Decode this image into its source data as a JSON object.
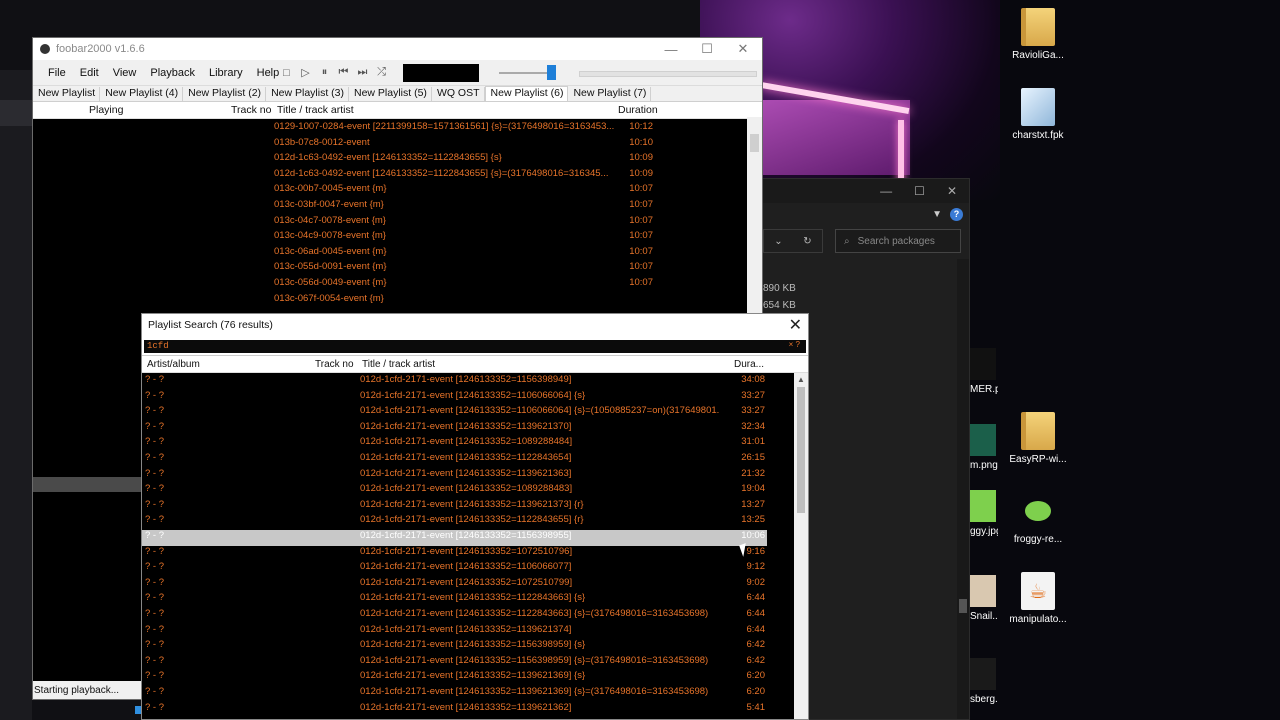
{
  "desktop": {
    "icons": [
      {
        "label": "RavioliGa...",
        "kind": "folder-icon"
      },
      {
        "label": "charstxt.fpk",
        "kind": "file-icon"
      },
      {
        "label": "EasyRP-wi...",
        "kind": "folder-icon"
      },
      {
        "label": "froggy-re...",
        "kind": "frog-icon"
      },
      {
        "label": "manipulato...",
        "kind": "java-icon"
      }
    ],
    "partial_icons": [
      "MER.png",
      "m.png",
      "ggy.jpg",
      "Snail...",
      "sberg..."
    ]
  },
  "background_window": {
    "search_placeholder": "Search packages",
    "sizes": [
      "890 KB",
      "654 KB"
    ]
  },
  "foobar": {
    "title": "foobar2000 v1.6.6",
    "menu": [
      "File",
      "Edit",
      "View",
      "Playback",
      "Library",
      "Help"
    ],
    "tabs": [
      "New Playlist",
      "New Playlist (4)",
      "New Playlist (2)",
      "New Playlist (3)",
      "New Playlist (5)",
      "WQ OST",
      "New Playlist (6)",
      "New Playlist (7)"
    ],
    "active_tab_index": 6,
    "columns": {
      "playing": "Playing",
      "track_no": "Track no",
      "title": "Title / track artist",
      "duration": "Duration"
    },
    "rows": [
      {
        "title": "0129-1007-0284-event [2211399158=1571361561] {s}=(3176498016=3163453...",
        "duration": "10:12"
      },
      {
        "title": "013b-07c8-0012-event",
        "duration": "10:10"
      },
      {
        "title": "012d-1c63-0492-event [1246133352=1122843655] {s}",
        "duration": "10:09"
      },
      {
        "title": "012d-1c63-0492-event [1246133352=1122843655] {s}=(3176498016=316345...",
        "duration": "10:09"
      },
      {
        "title": "013c-00b7-0045-event {m}",
        "duration": "10:07"
      },
      {
        "title": "013c-03bf-0047-event {m}",
        "duration": "10:07"
      },
      {
        "title": "013c-04c7-0078-event {m}",
        "duration": "10:07"
      },
      {
        "title": "013c-04c9-0078-event {m}",
        "duration": "10:07"
      },
      {
        "title": "013c-06ad-0045-event {m}",
        "duration": "10:07"
      },
      {
        "title": "013c-055d-0091-event {m}",
        "duration": "10:07"
      },
      {
        "title": "013c-056d-0049-event {m}",
        "duration": "10:07"
      },
      {
        "title": "013c-067f-0054-event {m}",
        "duration": ""
      }
    ],
    "status": "Starting playback..."
  },
  "search_dialog": {
    "title": "Playlist Search (76 results)",
    "query": "1cfd",
    "columns": {
      "artist": "Artist/album",
      "track_no": "Track no",
      "title": "Title / track artist",
      "duration": "Dura..."
    },
    "selected_index": 10,
    "rows": [
      {
        "artist": "? - ?",
        "title": "012d-1cfd-2171-event [1246133352=1156398949]",
        "duration": "34:08"
      },
      {
        "artist": "? - ?",
        "title": "012d-1cfd-2171-event [1246133352=1106066064] {s}",
        "duration": "33:27"
      },
      {
        "artist": "? - ?",
        "title": "012d-1cfd-2171-event [1246133352=1106066064] {s}=(1050885237=on)(317649801...",
        "duration": "33:27"
      },
      {
        "artist": "? - ?",
        "title": "012d-1cfd-2171-event [1246133352=1139621370]",
        "duration": "32:34"
      },
      {
        "artist": "? - ?",
        "title": "012d-1cfd-2171-event [1246133352=1089288484]",
        "duration": "31:01"
      },
      {
        "artist": "? - ?",
        "title": "012d-1cfd-2171-event [1246133352=1122843654]",
        "duration": "26:15"
      },
      {
        "artist": "? - ?",
        "title": "012d-1cfd-2171-event [1246133352=1139621363]",
        "duration": "21:32"
      },
      {
        "artist": "? - ?",
        "title": "012d-1cfd-2171-event [1246133352=1089288483]",
        "duration": "19:04"
      },
      {
        "artist": "? - ?",
        "title": "012d-1cfd-2171-event [1246133352=1139621373] {r}",
        "duration": "13:27"
      },
      {
        "artist": "? - ?",
        "title": "012d-1cfd-2171-event [1246133352=1122843655] {r}",
        "duration": "13:25"
      },
      {
        "artist": "? - ?",
        "title": "012d-1cfd-2171-event [1246133352=1156398955]",
        "duration": "10:06"
      },
      {
        "artist": "? - ?",
        "title": "012d-1cfd-2171-event [1246133352=1072510796]",
        "duration": "9:16"
      },
      {
        "artist": "? - ?",
        "title": "012d-1cfd-2171-event [1246133352=1106066077]",
        "duration": "9:12"
      },
      {
        "artist": "? - ?",
        "title": "012d-1cfd-2171-event [1246133352=1072510799]",
        "duration": "9:02"
      },
      {
        "artist": "? - ?",
        "title": "012d-1cfd-2171-event [1246133352=1122843663] {s}",
        "duration": "6:44"
      },
      {
        "artist": "? - ?",
        "title": "012d-1cfd-2171-event [1246133352=1122843663] {s}=(3176498016=3163453698)",
        "duration": "6:44"
      },
      {
        "artist": "? - ?",
        "title": "012d-1cfd-2171-event [1246133352=1139621374]",
        "duration": "6:44"
      },
      {
        "artist": "? - ?",
        "title": "012d-1cfd-2171-event [1246133352=1156398959] {s}",
        "duration": "6:42"
      },
      {
        "artist": "? - ?",
        "title": "012d-1cfd-2171-event [1246133352=1156398959] {s}=(3176498016=3163453698)",
        "duration": "6:42"
      },
      {
        "artist": "? - ?",
        "title": "012d-1cfd-2171-event [1246133352=1139621369] {s}",
        "duration": "6:20"
      },
      {
        "artist": "? - ?",
        "title": "012d-1cfd-2171-event [1246133352=1139621369] {s}=(3176498016=3163453698)",
        "duration": "6:20"
      },
      {
        "artist": "? - ?",
        "title": "012d-1cfd-2171-event [1246133352=1139621362]",
        "duration": "5:41"
      }
    ]
  },
  "colors": {
    "accent_text": "#e8742a",
    "selection": "#c8c8c8",
    "volume_thumb": "#1e7fd8"
  }
}
